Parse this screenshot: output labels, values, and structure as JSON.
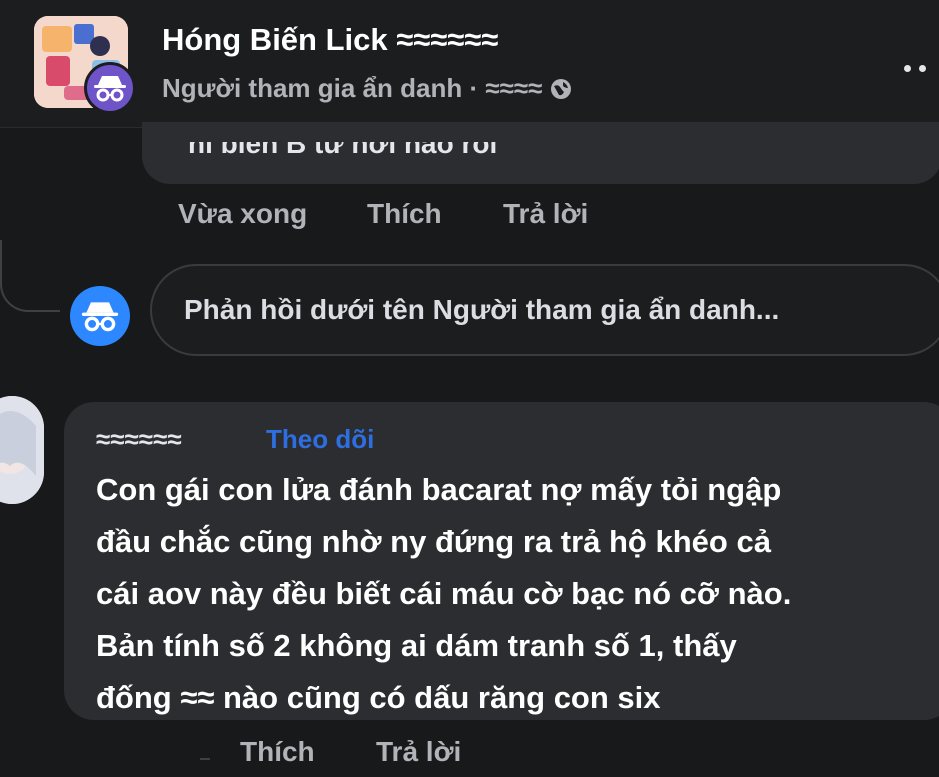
{
  "header": {
    "name": "Hóng Biến Lick ≈≈≈≈≈≈",
    "meta": "Người tham gia ẩn danh · ≈≈≈≈",
    "more_icon": "more-icon",
    "group_avatar_icon": "group-avatar",
    "anon_badge_icon": "incognito-icon",
    "globe_icon": "globe-icon"
  },
  "previous_comment": {
    "text": "hi biến B từ nơi nào rồi",
    "actions": {
      "time": "Vừa xong",
      "like": "Thích",
      "reply": "Trả lời"
    }
  },
  "reply_box": {
    "avatar_icon": "incognito-icon",
    "placeholder": "Phản hồi dưới tên Người tham gia ẩn danh..."
  },
  "comment": {
    "author": "≈≈≈≈≈≈",
    "follow_label": "Theo dõi",
    "lines": [
      "Con gái con lửa đánh bacarat nợ mấy tỏi ngập",
      "đầu chắc cũng nhờ ny đứng ra trả hộ khéo cả",
      "cái aov này đều biết cái máu cờ bạc nó cỡ nào.",
      "Bản tính số 2 không ai dám tranh số 1, thấy",
      "đống ≈≈ nào cũng có dấu răng con six"
    ],
    "actions": {
      "like": "Thích",
      "reply": "Trả lời"
    }
  },
  "colors": {
    "background": "#18191b",
    "bubble": "#2c2d30",
    "link": "#2d6fe0",
    "anon_badge": "#6e53c9",
    "reply_avatar": "#2d88ff"
  }
}
